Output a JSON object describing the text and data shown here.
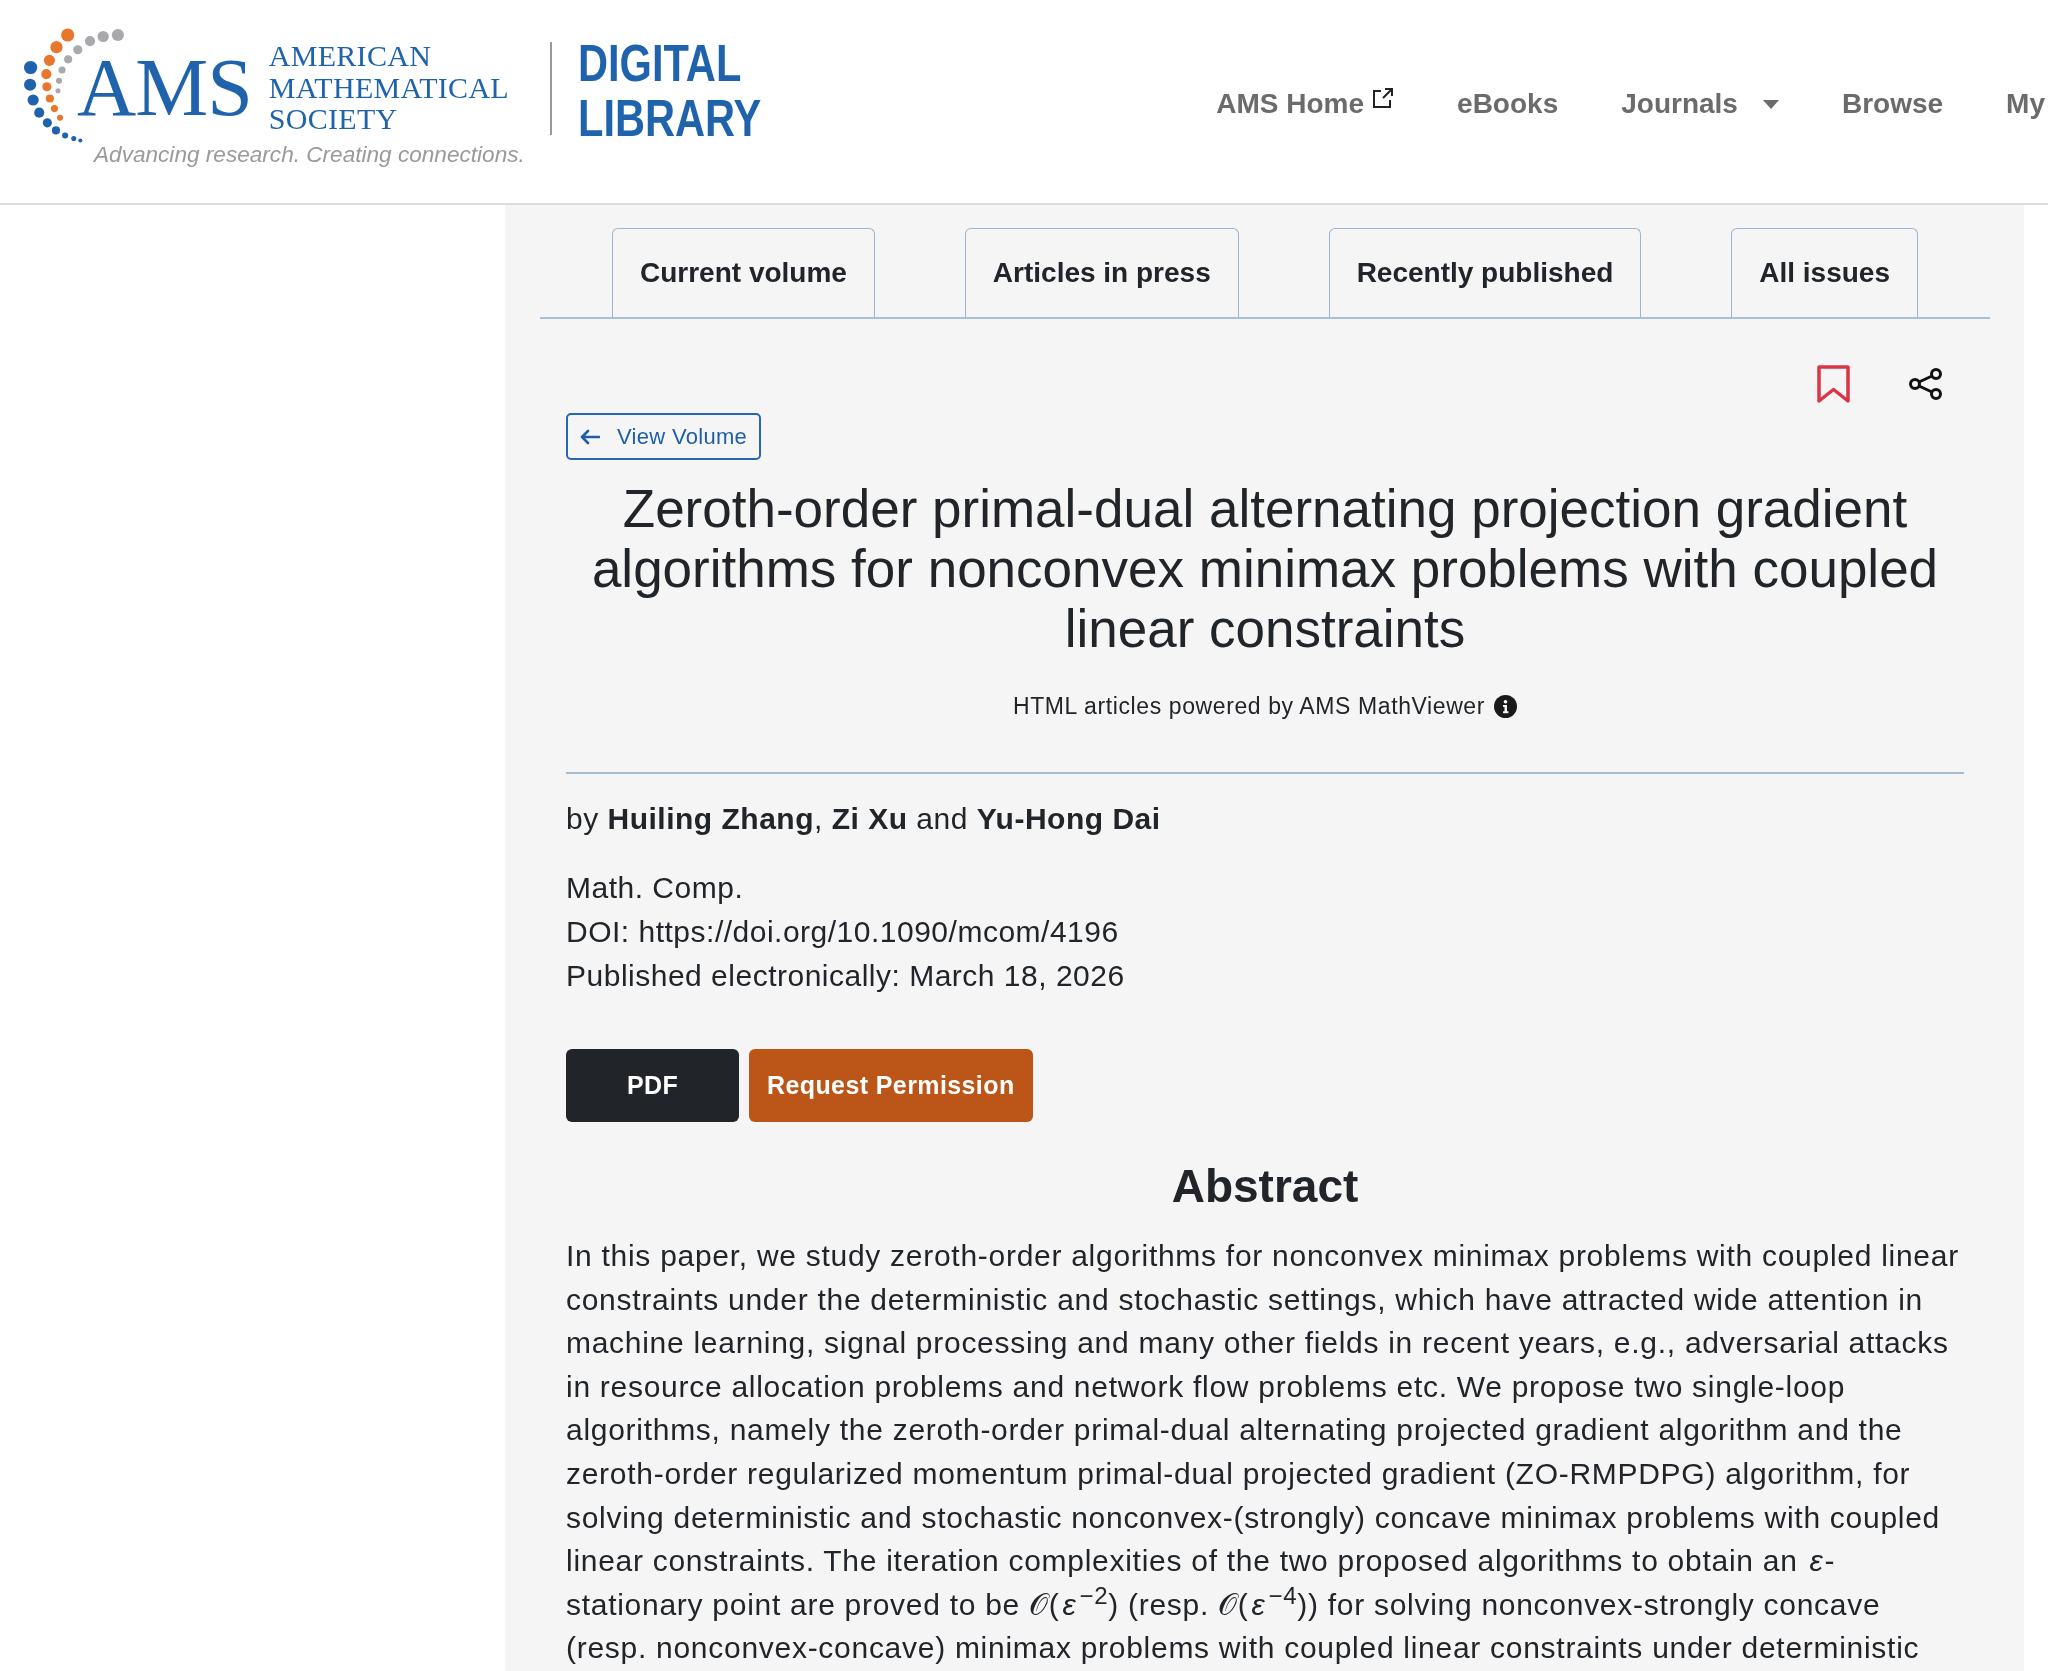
{
  "header": {
    "logo": {
      "mark": "AMS",
      "society_name": "AMERICAN MATHEMATICAL SOCIETY",
      "tagline": "Advancing research. Creating connections.",
      "library_name": "DIGITAL LIBRARY"
    },
    "nav": [
      {
        "label": "AMS Home",
        "kind": "external"
      },
      {
        "label": "eBooks",
        "kind": "link"
      },
      {
        "label": "Journals",
        "kind": "dropdown"
      },
      {
        "label": "Browse",
        "kind": "link"
      },
      {
        "label": "My",
        "kind": "link"
      }
    ]
  },
  "tabs": [
    {
      "label": "Current volume",
      "selected": false
    },
    {
      "label": "Articles in press",
      "selected": false
    },
    {
      "label": "Recently published",
      "selected": false
    },
    {
      "label": "All issues",
      "selected": false
    }
  ],
  "article": {
    "back_link": "View Volume",
    "title": "Zeroth-order primal-dual alternating projection gradient algorithms for nonconvex minimax problems with coupled linear constraints",
    "mathviewer_note": "HTML articles powered by AMS MathViewer",
    "byline": "by **Huiling Zhang**, **Zi Xu** and **Yu-Hong Dai**",
    "journal": "Math. Comp.",
    "doi": "DOI: https://doi.org/10.1090/mcom/4196",
    "published": "Published electronically: March 18, 2026",
    "buttons": [
      {
        "label": "PDF",
        "kind": "dark"
      },
      {
        "label": "Request Permission",
        "kind": "accent"
      }
    ],
    "abstract_heading": "Abstract",
    "abstract": "In this paper, we study zeroth-order algorithms for nonconvex minimax problems with coupled linear constraints under the deterministic and stochastic settings, which have attracted wide attention in machine learning, signal processing and many other fields in recent years, e.g., adversarial attacks in resource allocation problems and network flow problems etc. We propose two single-loop algorithms, namely the zeroth-order primal-dual alternating projected gradient algorithm and the zeroth-order regularized momentum primal-dual projected gradient (ZO-RMPDPG) algorithm, for solving deterministic and stochastic nonconvex-(strongly) concave minimax problems with coupled linear constraints. The iteration complexities of the two proposed algorithms to obtain an *ε*-stationary point are proved to be 𝒪(*ε*$^{−2}$) (resp. 𝒪(*ε*$^{−4}$)) for solving nonconvex-strongly concave (resp. nonconvex-concave) minimax problems with coupled linear constraints under deterministic"
  }
}
